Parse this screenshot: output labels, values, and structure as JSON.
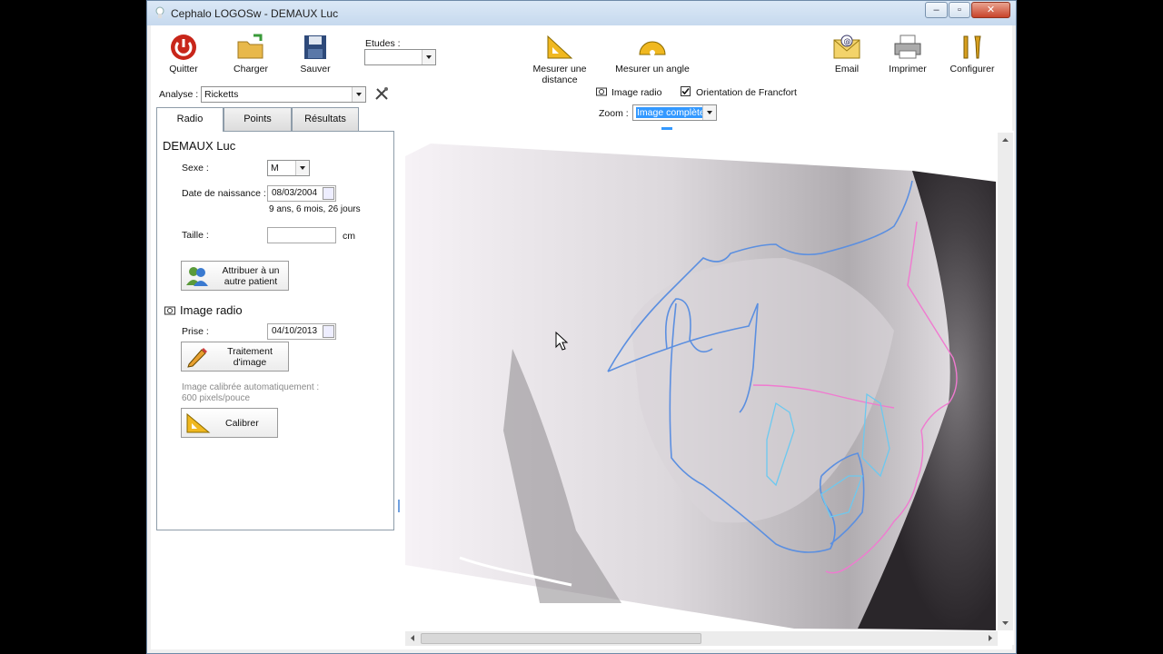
{
  "window": {
    "title": "Cephalo LOGOSw - DEMAUX Luc",
    "minimize": "–",
    "maximize": "▫",
    "close": "✕"
  },
  "toolbar": {
    "quit": "Quitter",
    "load": "Charger",
    "save": "Sauver",
    "studies_label": "Etudes :",
    "studies_value": "",
    "measure_distance": "Mesurer une distance",
    "measure_angle": "Mesurer un angle",
    "email": "Email",
    "print": "Imprimer",
    "configure": "Configurer"
  },
  "analysis": {
    "label": "Analyse :",
    "value": "Ricketts"
  },
  "view": {
    "image_radio": "Image radio",
    "francfort": "Orientation de Francfort",
    "francfort_checked": true,
    "zoom_label": "Zoom :",
    "zoom_value": "Image complète"
  },
  "tabs": [
    {
      "label": "Radio"
    },
    {
      "label": "Points"
    },
    {
      "label": "Résultats"
    }
  ],
  "patient": {
    "name": "DEMAUX Luc",
    "sex_label": "Sexe :",
    "sex_value": "M",
    "dob_label": "Date de naissance :",
    "dob_value": "08/03/2004",
    "age": "9 ans, 6 mois, 26 jours",
    "height_label": "Taille :",
    "height_value": "",
    "height_unit": "cm",
    "assign_button": "Attribuer à un autre patient"
  },
  "radio": {
    "title": "Image radio",
    "taken_label": "Prise :",
    "taken_value": "04/10/2013",
    "treatment_button": "Traitement d'image",
    "calibration_note_1": "Image calibrée automatiquement :",
    "calibration_note_2": "600 pixels/pouce",
    "calibrate_button": "Calibrer"
  },
  "colors": {
    "tracing_blue": "#5b8fe0",
    "tracing_pink": "#f07ad0",
    "tracing_cyan": "#6cc9f0",
    "selection": "#3399ff"
  }
}
